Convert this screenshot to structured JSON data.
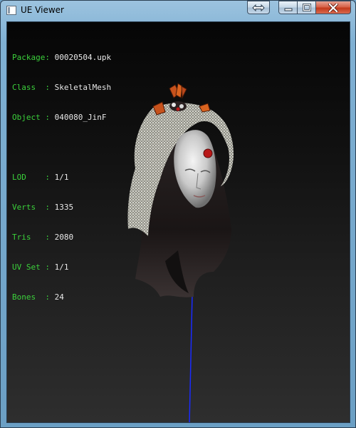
{
  "window": {
    "title": "UE Viewer"
  },
  "titlebar_buttons": {
    "restore_wide": "restore-arrows-icon",
    "minimize": "minimize-icon",
    "maximize": "maximize-icon",
    "close": "close-icon"
  },
  "info": {
    "package_label": "Package: ",
    "package_value": "00020504.upk",
    "class_label": "Class  : ",
    "class_value": "SkeletalMesh",
    "object_label": "Object : ",
    "object_value": "040080_JinF",
    "lod_label": "LOD    : ",
    "lod_value": "1/1",
    "verts_label": "Verts  : ",
    "verts_value": "1335",
    "tris_label": "Tris   : ",
    "tris_value": "2080",
    "uvset_label": "UV Set : ",
    "uvset_value": "1/1",
    "bones_label": "Bones  : ",
    "bones_value": "24"
  },
  "colors": {
    "label_green": "#3bd13b",
    "value_white": "#e8e8e8",
    "axis_blue": "#1a2bff"
  }
}
